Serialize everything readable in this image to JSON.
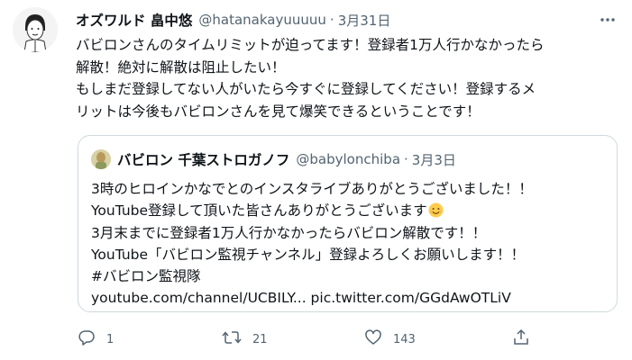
{
  "tweet": {
    "author_name": "オズワルド 畠中悠",
    "author_handle": "@hatanakayuuuuu",
    "separator": "·",
    "date": "3月31日",
    "body_lines": [
      "バビロンさんのタイムリミットが迫ってます！登録者1万人行かなかったら",
      "解散！絶対に解散は阻止したい！",
      "もしまだ登録してない人がいたら今すぐに登録してください！登録するメ",
      "リットは今後もバビロンさんを見て爆笑できるということです！"
    ]
  },
  "quoted_tweet": {
    "author_name": "バビロン 千葉ストロガノフ",
    "author_handle": "@babylonchiba",
    "separator": "·",
    "date": "3月3日",
    "lines": [
      "3時のヒロインかなでとのインスタライブありがとうございました！！",
      "YouTube登録して頂いた皆さんありがとうございます",
      "3月末までに登録者1万人行かなかったらバビロン解散です！！",
      "YouTube「バビロン監視チャンネル」登録よろしくお願いします！！",
      "#バビロン監視隊",
      "youtube.com/channel/UCBILY... pic.twitter.com/GGdAwOTLiV"
    ]
  },
  "actions": {
    "reply_count": "1",
    "retweet_count": "21",
    "like_count": "143"
  },
  "icons": {
    "more": "more-options-icon",
    "reply": "reply-icon",
    "retweet": "retweet-icon",
    "like": "like-icon",
    "share": "share-icon",
    "emoji": "smiling-face-emoji"
  },
  "colors": {
    "text": "#0f1419",
    "secondary": "#536471",
    "border": "#cfd9de"
  }
}
